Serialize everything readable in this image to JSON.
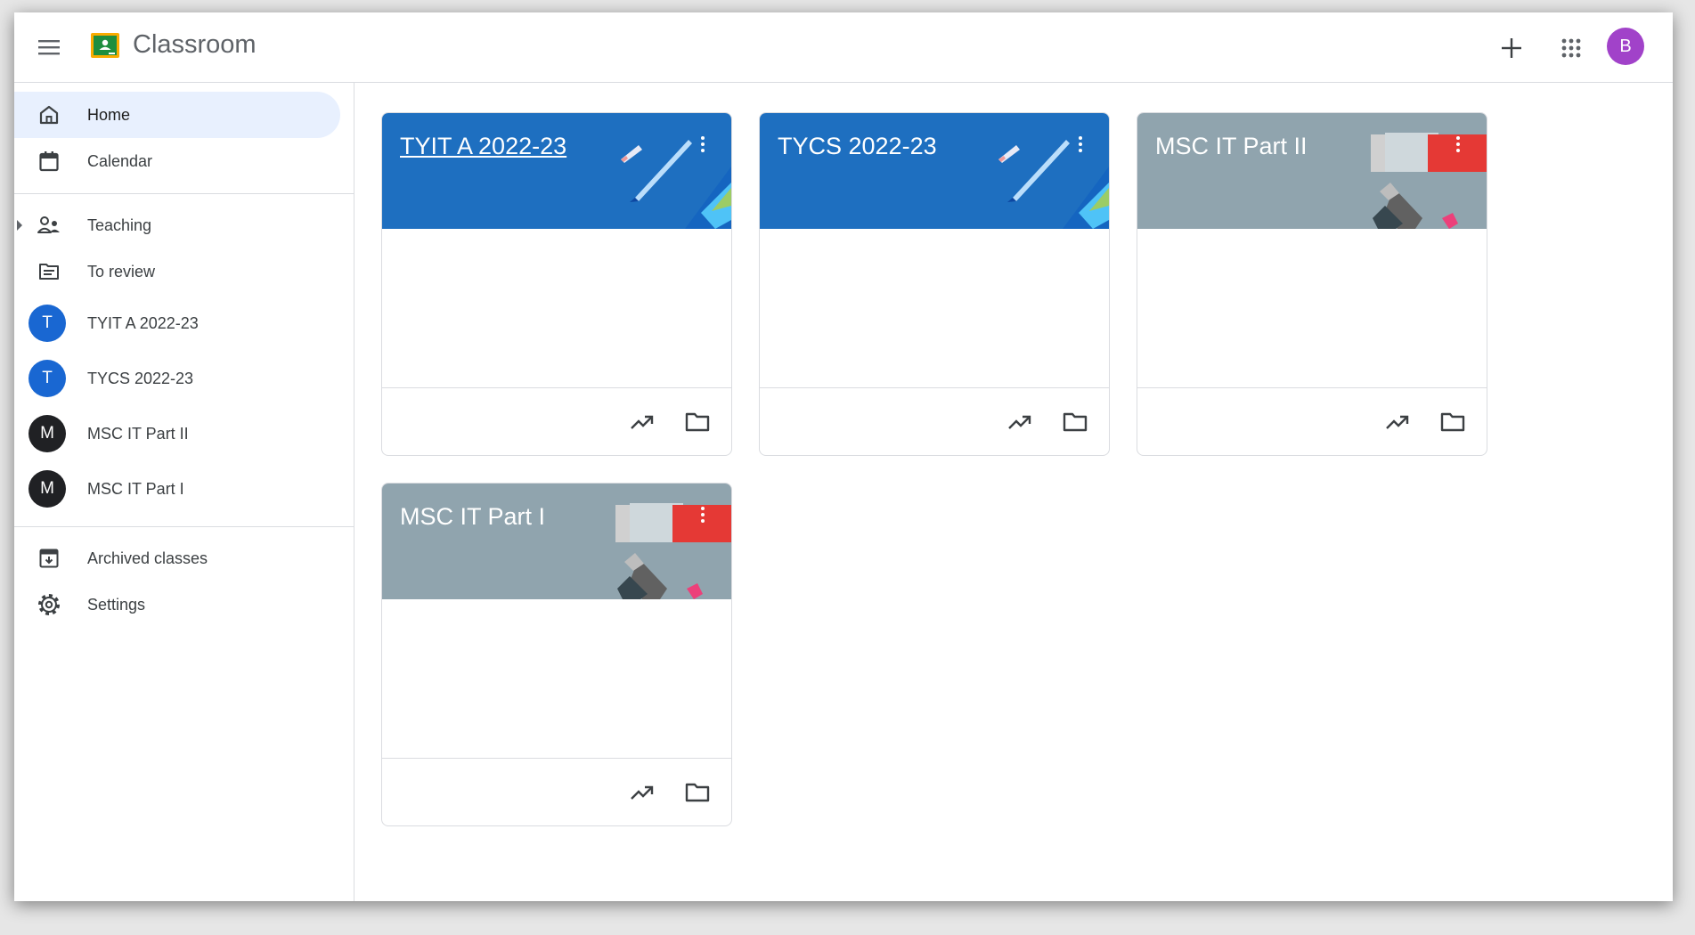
{
  "app": {
    "title": "Classroom"
  },
  "header": {
    "menu_icon": "hamburger-menu-icon",
    "logo_icon": "classroom-logo-icon",
    "create_icon": "plus-icon",
    "apps_icon": "google-apps-grid-icon",
    "account_initial": "B",
    "account_color": "#a142c9"
  },
  "sidebar": {
    "home": "Home",
    "calendar": "Calendar",
    "teaching": "Teaching",
    "to_review": "To review",
    "classes": [
      {
        "initial": "T",
        "name": "TYIT A 2022-23",
        "color": "#1967d2"
      },
      {
        "initial": "T",
        "name": "TYCS 2022-23",
        "color": "#1967d2"
      },
      {
        "initial": "M",
        "name": "MSC IT Part II",
        "color": "#202124"
      },
      {
        "initial": "M",
        "name": "MSC IT Part I",
        "color": "#202124"
      }
    ],
    "archived": "Archived classes",
    "settings": "Settings"
  },
  "cards": [
    {
      "title": "TYIT A 2022-23",
      "theme": "blue",
      "header_color": "#1e6fc0",
      "art": "pencils-art",
      "focused": true
    },
    {
      "title": "TYCS 2022-23",
      "theme": "blue",
      "header_color": "#1e6fc0",
      "art": "pencils-art",
      "focused": false
    },
    {
      "title": "MSC IT Part II",
      "theme": "grey",
      "header_color": "#90a4ae",
      "art": "paint-tube-art",
      "focused": false
    },
    {
      "title": "MSC IT Part I",
      "theme": "grey",
      "header_color": "#90a4ae",
      "art": "paint-tube-art",
      "focused": false
    }
  ],
  "card_actions": {
    "trending_icon": "trending-up-icon",
    "folder_icon": "folder-icon"
  }
}
